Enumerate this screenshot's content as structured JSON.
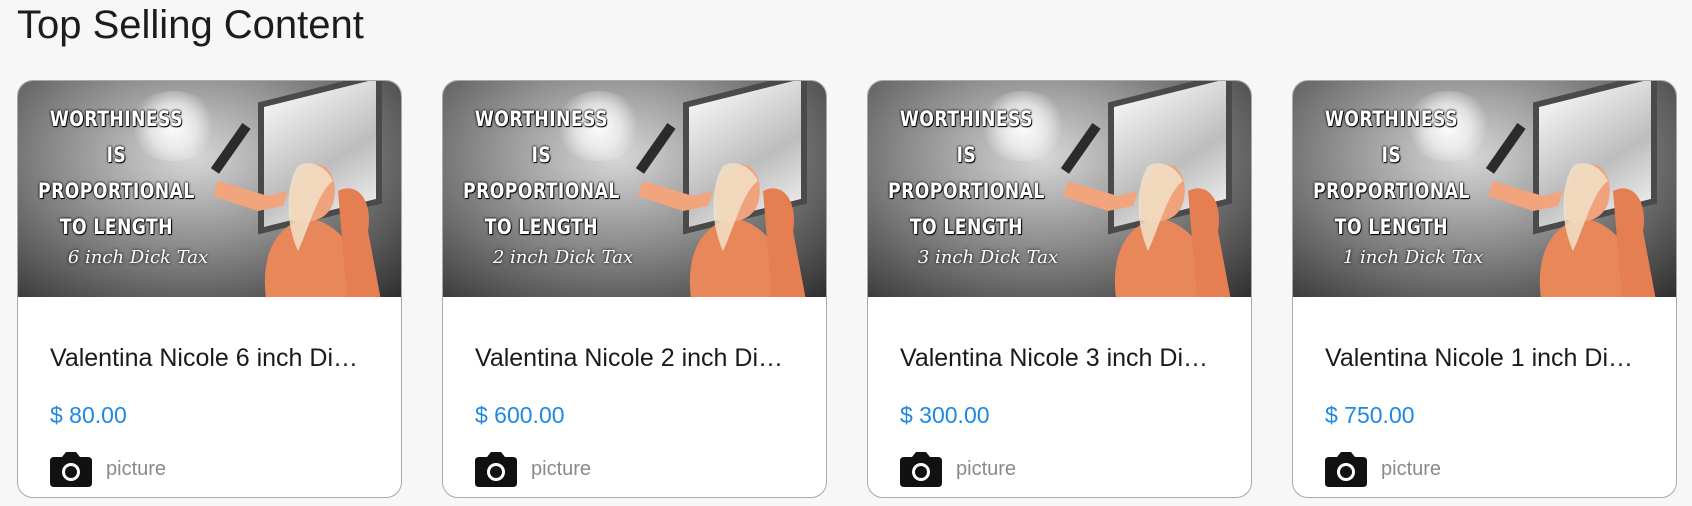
{
  "section": {
    "title": "Top Selling Content"
  },
  "cards": [
    {
      "title": "Valentina Nicole 6 inch Di…",
      "price": "$ 80.00",
      "type_label": "picture",
      "type_icon": "camera-icon",
      "image": {
        "lines": [
          "WORTHINESS",
          "IS",
          "PROPORTIONAL",
          "TO LENGTH"
        ],
        "subline": "6 inch Dick Tax"
      }
    },
    {
      "title": "Valentina Nicole 2 inch Di…",
      "price": "$ 600.00",
      "type_label": "picture",
      "type_icon": "camera-icon",
      "image": {
        "lines": [
          "WORTHINESS",
          "IS",
          "PROPORTIONAL",
          "TO LENGTH"
        ],
        "subline": "2 inch Dick Tax"
      }
    },
    {
      "title": "Valentina Nicole 3 inch Di…",
      "price": "$ 300.00",
      "type_label": "picture",
      "type_icon": "camera-icon",
      "image": {
        "lines": [
          "WORTHINESS",
          "IS",
          "PROPORTIONAL",
          "TO LENGTH"
        ],
        "subline": "3 inch Dick Tax"
      }
    },
    {
      "title": "Valentina Nicole 1 inch Di…",
      "price": "$ 750.00",
      "type_label": "picture",
      "type_icon": "camera-icon",
      "image": {
        "lines": [
          "WORTHINESS",
          "IS",
          "PROPORTIONAL",
          "TO LENGTH"
        ],
        "subline": "1 inch Dick Tax"
      }
    }
  ],
  "colors": {
    "price": "#1e88e5",
    "title": "#1c1c1c",
    "muted": "#8a8a8a",
    "card_border": "#a9a9a9",
    "page_background": "#f7f7f7"
  }
}
